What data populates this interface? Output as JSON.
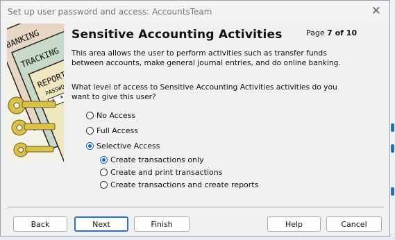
{
  "window": {
    "title": "Set up user password and access: AccountsTeam"
  },
  "header": {
    "title": "Sensitive Accounting Activities",
    "page_prefix": "Page ",
    "page_value": "7 of 10"
  },
  "illustration": {
    "cards": [
      "BANKING",
      "TRACKING",
      "REPORTS",
      "PASSWORD"
    ]
  },
  "description": "This area allows the user to perform activities such as transfer funds between accounts, make general journal entries, and do online banking.",
  "question": "What level of access to Sensitive Accounting Activities activities do you want to give this user?",
  "access_options": [
    {
      "label": "No Access",
      "selected": false
    },
    {
      "label": "Full Access",
      "selected": false
    },
    {
      "label": "Selective Access",
      "selected": true
    }
  ],
  "selective_options": [
    {
      "label": "Create transactions only",
      "selected": true
    },
    {
      "label": "Create and print transactions",
      "selected": false
    },
    {
      "label": "Create transactions and create reports",
      "selected": false
    }
  ],
  "buttons": {
    "back": "Back",
    "next": "Next",
    "finish": "Finish",
    "help": "Help",
    "cancel": "Cancel"
  },
  "colors": {
    "accent": "#1a63c6",
    "dialog_bg": "#f0f0f0"
  }
}
